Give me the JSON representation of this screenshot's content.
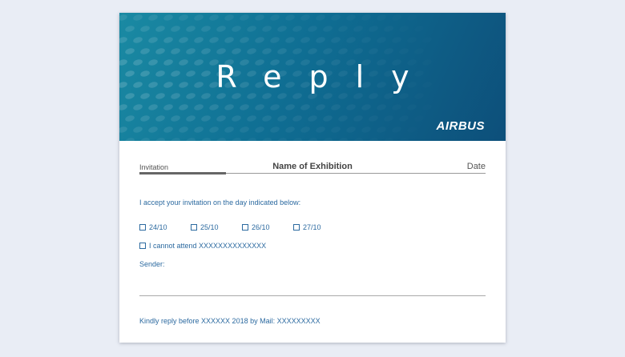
{
  "banner": {
    "title": "Reply",
    "logo": "AIRBUS",
    "colors": {
      "start": "#1a8aa3",
      "end": "#0d4f7a"
    }
  },
  "header": {
    "invitation_label": "Invitation",
    "exhibition_label": "Name of Exhibition",
    "date_label": "Date"
  },
  "form": {
    "accept_text": "I accept your invitation on the day indicated below:",
    "days": [
      "24/10",
      "25/10",
      "26/10",
      "27/10"
    ],
    "cannot_attend": "I cannot attend XXXXXXXXXXXXXX",
    "sender_label": "Sender:",
    "footer": "Kindly reply before XXXXXX 2018 by Mail: XXXXXXXXX"
  },
  "accent_color": "#2c6aa0"
}
